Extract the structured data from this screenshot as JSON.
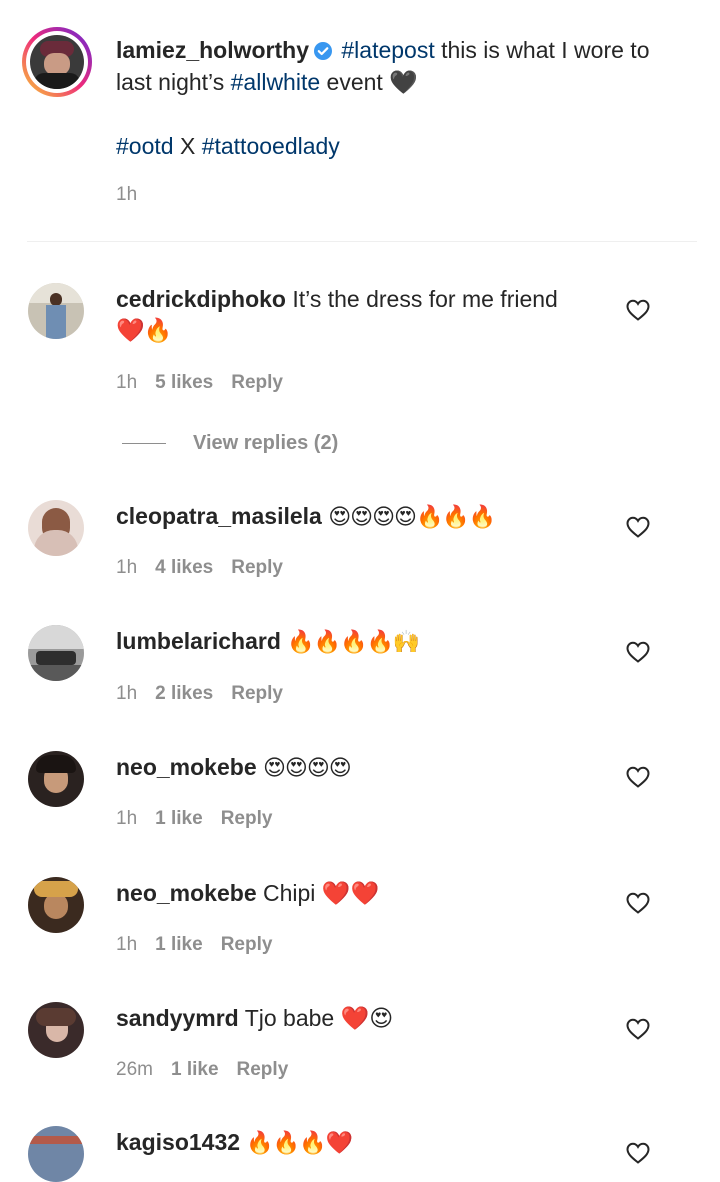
{
  "post": {
    "username": "lamiez_holworthy",
    "caption_parts": [
      {
        "t": "#latepost",
        "tag": true
      },
      {
        "t": " this is what I wore to last night’s ",
        "tag": false
      },
      {
        "t": "#allwhite",
        "tag": true
      },
      {
        "t": " event ",
        "tag": false
      },
      {
        "t": "🖤",
        "tag": false
      }
    ],
    "tags_line": [
      {
        "t": "#ootd",
        "tag": true
      },
      {
        "t": " X ",
        "tag": false
      },
      {
        "t": "#tattooedlady",
        "tag": true
      }
    ],
    "time": "1h"
  },
  "view_replies": "View replies (2)",
  "comments": [
    {
      "username": "cedrickdiphoko",
      "text": "It’s the dress for me friend",
      "emoji_line": "❤️🔥",
      "time": "1h",
      "likes": "5 likes",
      "reply": "Reply"
    },
    {
      "username": "cleopatra_masilela",
      "text": "😍😍😍😍🔥🔥🔥",
      "time": "1h",
      "likes": "4 likes",
      "reply": "Reply"
    },
    {
      "username": "lumbelarichard",
      "text": "🔥🔥🔥🔥🙌",
      "time": "1h",
      "likes": "2 likes",
      "reply": "Reply"
    },
    {
      "username": "neo_mokebe",
      "text": "😍😍😍😍",
      "time": "1h",
      "likes": "1 like",
      "reply": "Reply"
    },
    {
      "username": "neo_mokebe",
      "text": "Chipi ❤️❤️",
      "time": "1h",
      "likes": "1 like",
      "reply": "Reply"
    },
    {
      "username": "sandyymrd",
      "text": "Tjo babe ❤️😍",
      "time": "26m",
      "likes": "1 like",
      "reply": "Reply"
    },
    {
      "username": "kagiso1432",
      "text": "🔥🔥🔥❤️"
    }
  ],
  "colors": {
    "hashtag": "#00376b",
    "verified": "#3897f0",
    "meta": "#8e8e8e"
  }
}
